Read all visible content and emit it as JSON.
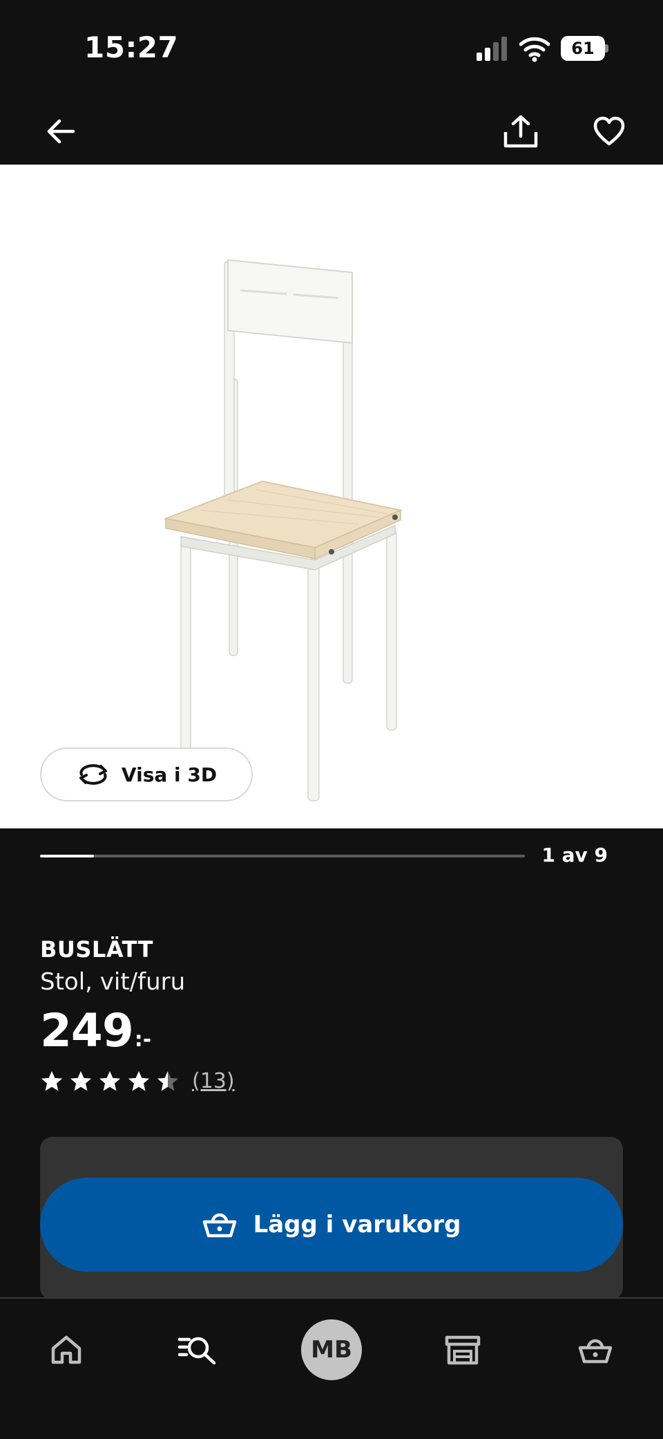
{
  "status_bar": {
    "time": "15:27",
    "battery": "61"
  },
  "top_nav": {
    "back_icon": "arrow-left-icon",
    "share_icon": "share-icon",
    "favorite_icon": "heart-icon"
  },
  "gallery": {
    "view_3d_label": "Visa i 3D",
    "counter": "1 av 9",
    "current": 1,
    "total": 9
  },
  "product": {
    "name": "BUSLÄTT",
    "description": "Stol, vit/furu",
    "price": "249",
    "price_suffix": ":-",
    "rating": 4.5,
    "review_count": "(13)"
  },
  "cart": {
    "add_label": "Lägg i varukorg",
    "button_color": "#0058a3"
  },
  "bottom_nav": {
    "avatar_initials": "MB",
    "tabs": [
      "home-icon",
      "search-list-icon",
      "avatar",
      "store-icon",
      "basket-icon"
    ]
  }
}
